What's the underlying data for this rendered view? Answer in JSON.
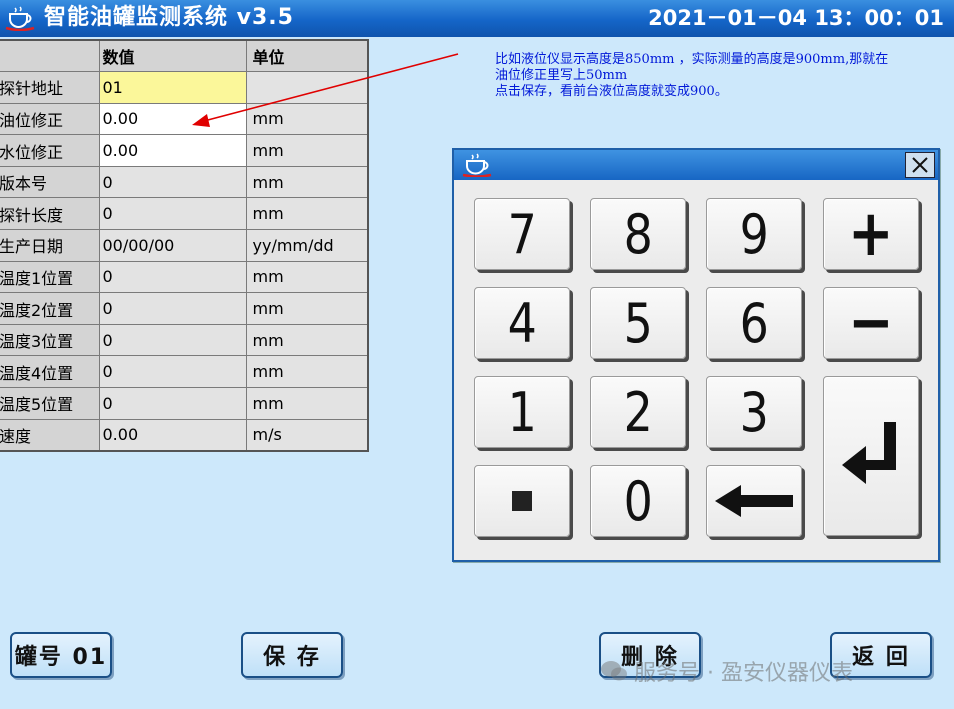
{
  "header": {
    "title": "智能油罐监测系统 v3.5",
    "datetime": "2021－01－04  13：00：01"
  },
  "table": {
    "columns": [
      "",
      "数值",
      "单位"
    ],
    "rows": [
      {
        "label": "探针地址",
        "value": "01",
        "unit": ""
      },
      {
        "label": "油位修正",
        "value": "0.00",
        "unit": "mm"
      },
      {
        "label": "水位修正",
        "value": "0.00",
        "unit": "mm"
      },
      {
        "label": "版本号",
        "value": "0",
        "unit": "mm"
      },
      {
        "label": "探针长度",
        "value": "0",
        "unit": "mm"
      },
      {
        "label": "生产日期",
        "value": "00/00/00",
        "unit": "yy/mm/dd"
      },
      {
        "label": "温度1位置",
        "value": "0",
        "unit": "mm"
      },
      {
        "label": "温度2位置",
        "value": "0",
        "unit": "mm"
      },
      {
        "label": "温度3位置",
        "value": "0",
        "unit": "mm"
      },
      {
        "label": "温度4位置",
        "value": "0",
        "unit": "mm"
      },
      {
        "label": "温度5位置",
        "value": "0",
        "unit": "mm"
      },
      {
        "label": "速度",
        "value": "0.00",
        "unit": "m/s"
      }
    ]
  },
  "annotation": {
    "line1": "比如液位仪显示高度是850mm ，实际测量的高度是900mm,那就在",
    "line2": "油位修正里写上50mm",
    "line3": "点击保存，看前台液位高度就变成900。"
  },
  "keypad": {
    "keys": [
      "7",
      "8",
      "9",
      "+",
      "4",
      "5",
      "6",
      "−",
      "1",
      "2",
      "3",
      "0"
    ],
    "close_icon": "close-icon",
    "dot_icon": "dot-icon",
    "backspace_icon": "left-arrow-icon",
    "enter_icon": "enter-icon"
  },
  "buttons": {
    "tank": "罐号 01",
    "save": "保 存",
    "delete": "删 除",
    "back": "返 回"
  },
  "watermark": "服务号 · 盈安仪器仪表",
  "colors": {
    "background": "#cde8fb",
    "titlebar": "#1565c8",
    "annotation": "#0018d8",
    "arrow": "#e00000",
    "address_cell": "#fbf79a"
  }
}
